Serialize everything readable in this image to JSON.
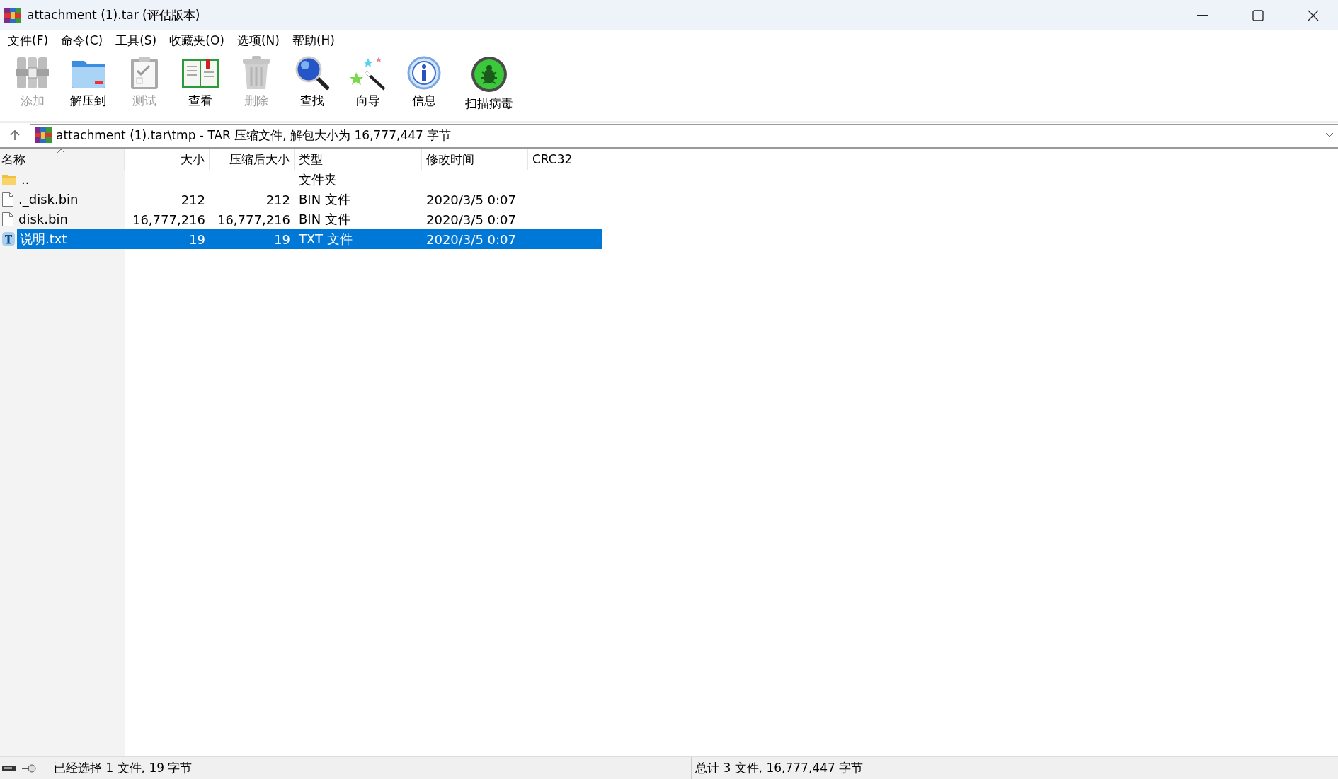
{
  "window": {
    "title": "attachment (1).tar (评估版本)"
  },
  "menu": [
    "文件(F)",
    "命令(C)",
    "工具(S)",
    "收藏夹(O)",
    "选项(N)",
    "帮助(H)"
  ],
  "toolbar": [
    {
      "label": "添加",
      "kind": "add",
      "disabled": true
    },
    {
      "label": "解压到",
      "kind": "extract",
      "disabled": false
    },
    {
      "label": "测试",
      "kind": "test",
      "disabled": true
    },
    {
      "label": "查看",
      "kind": "view",
      "disabled": false
    },
    {
      "label": "删除",
      "kind": "delete",
      "disabled": true
    },
    {
      "label": "查找",
      "kind": "find",
      "disabled": false
    },
    {
      "label": "向导",
      "kind": "wizard",
      "disabled": false
    },
    {
      "label": "信息",
      "kind": "info",
      "disabled": false
    },
    {
      "label": "扫描病毒",
      "kind": "scan",
      "disabled": false
    }
  ],
  "address": {
    "path": "attachment (1).tar\\tmp - TAR 压缩文件, 解包大小为 16,777,447 字节"
  },
  "table": {
    "columns": [
      "名称",
      "大小",
      "压缩后大小",
      "类型",
      "修改时间",
      "CRC32"
    ],
    "rows": [
      {
        "kind": "folder",
        "name": "..",
        "size": "",
        "packed": "",
        "type": "文件夹",
        "modified": "",
        "selected": false
      },
      {
        "kind": "file",
        "name": "._disk.bin",
        "size": "212",
        "packed": "212",
        "type": "BIN 文件",
        "modified": "2020/3/5 0:07",
        "selected": false
      },
      {
        "kind": "file",
        "name": "disk.bin",
        "size": "16,777,216",
        "packed": "16,777,216",
        "type": "BIN 文件",
        "modified": "2020/3/5 0:07",
        "selected": false
      },
      {
        "kind": "text",
        "name": "说明.txt",
        "size": "19",
        "packed": "19",
        "type": "TXT 文件",
        "modified": "2020/3/5 0:07",
        "selected": true
      }
    ]
  },
  "status_bar": {
    "left": "已经选择 1 文件, 19 字节",
    "right": "总计 3 文件, 16,777,447 字节"
  }
}
